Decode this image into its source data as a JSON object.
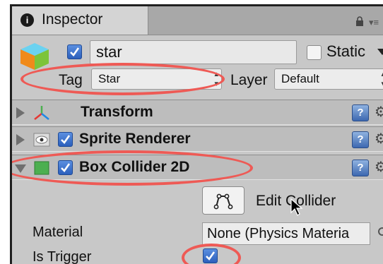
{
  "window": {
    "tab_title": "Inspector",
    "tab_icon": "info-icon"
  },
  "header": {
    "object_name": "star",
    "active": true,
    "static_label": "Static",
    "static_checked": false,
    "tag_label": "Tag",
    "tag_value": "Star",
    "layer_label": "Layer",
    "layer_value": "Default"
  },
  "components": [
    {
      "name": "Transform",
      "expanded": false,
      "icon": "transform-axes-icon"
    },
    {
      "name": "Sprite Renderer",
      "expanded": false,
      "enabled": true,
      "icon": "sprite-renderer-icon"
    },
    {
      "name": "Box Collider 2D",
      "expanded": true,
      "enabled": true,
      "icon": "box-collider-icon"
    }
  ],
  "collider": {
    "edit_label": "Edit Collider",
    "material_label": "Material",
    "material_value": "None (Physics Materia",
    "is_trigger_label": "Is Trigger",
    "is_trigger": true
  },
  "colors": {
    "annotation": "#ee5a55",
    "checkbox": "#2b5fbc",
    "panel_bg": "#c8c8c8",
    "row_bg": "#bdbdbd"
  }
}
